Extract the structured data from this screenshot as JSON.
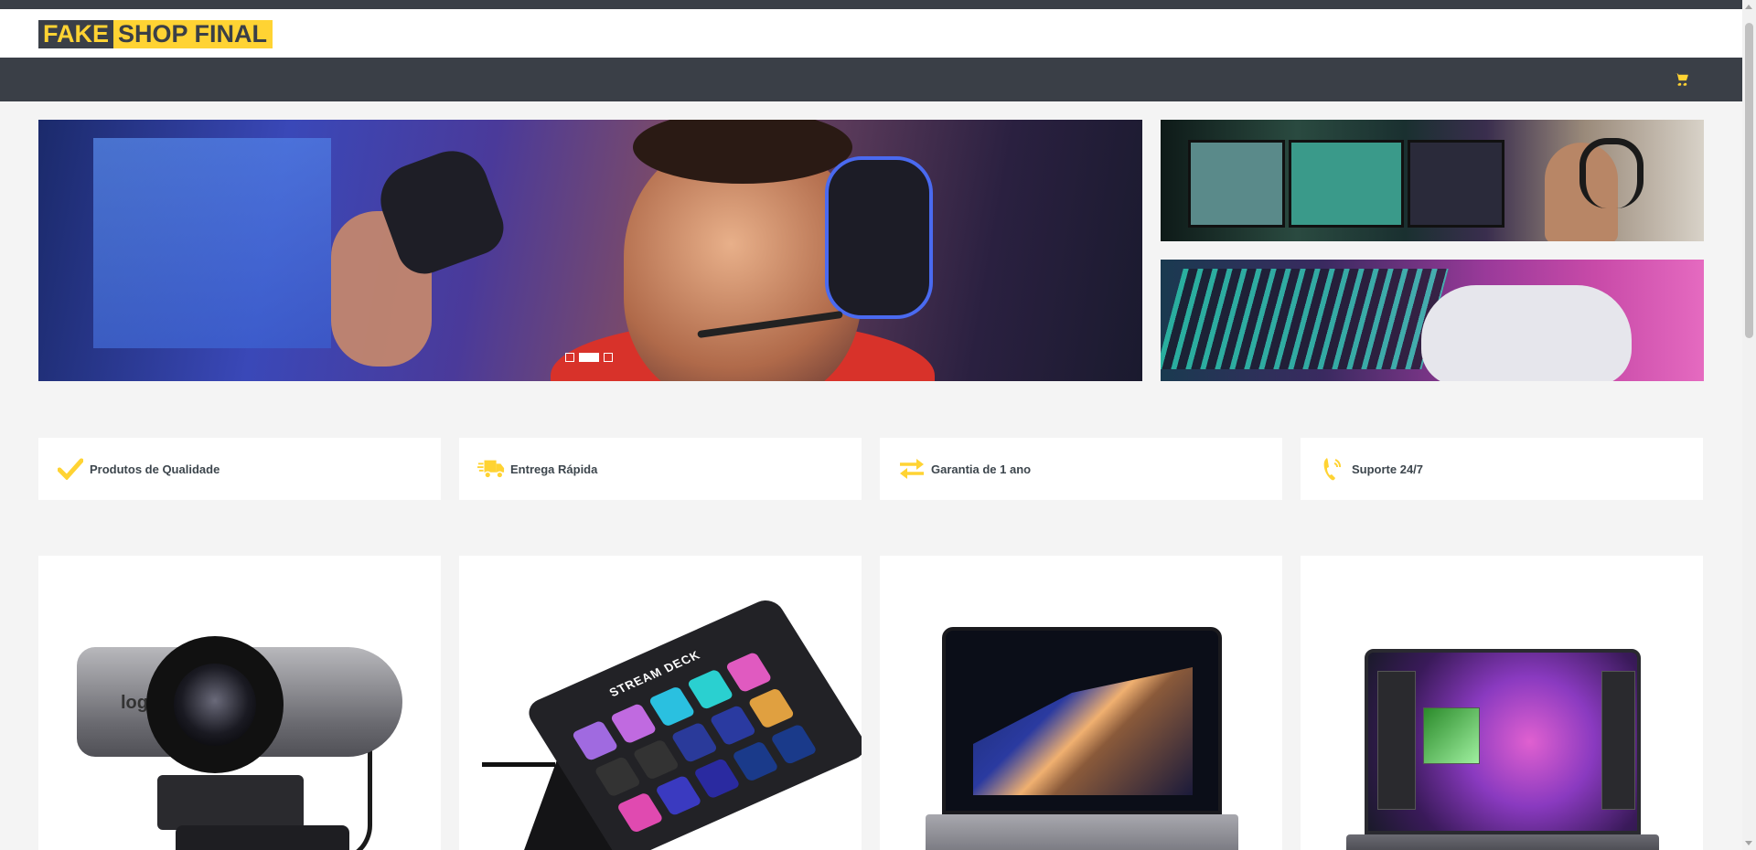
{
  "header": {
    "logo": {
      "part1": "FAKE",
      "part2": "SHOP FINAL"
    }
  },
  "navbar": {
    "cart_icon": "cart-icon"
  },
  "hero": {
    "main_alt_icon": "hero-gamer-headset-image",
    "dots": 3,
    "active_dot": 2
  },
  "features": [
    {
      "icon": "check-icon",
      "label": "Produtos de Qualidade"
    },
    {
      "icon": "shipping-fast-icon",
      "label": "Entrega Rápida"
    },
    {
      "icon": "exchange-icon",
      "label": "Garantia de 1 ano"
    },
    {
      "icon": "phone-volume-icon",
      "label": "Suporte 24/7"
    }
  ],
  "products": [
    {
      "image": "webcam-image",
      "brand_text": "logi"
    },
    {
      "image": "stream-deck-image",
      "brand_text": "STREAM DECK"
    },
    {
      "image": "laptop-image"
    },
    {
      "image": "laptop-creative-image"
    }
  ],
  "colors": {
    "accent": "#ffd333",
    "dark": "#3a3f47",
    "background": "#f4f4f4"
  }
}
